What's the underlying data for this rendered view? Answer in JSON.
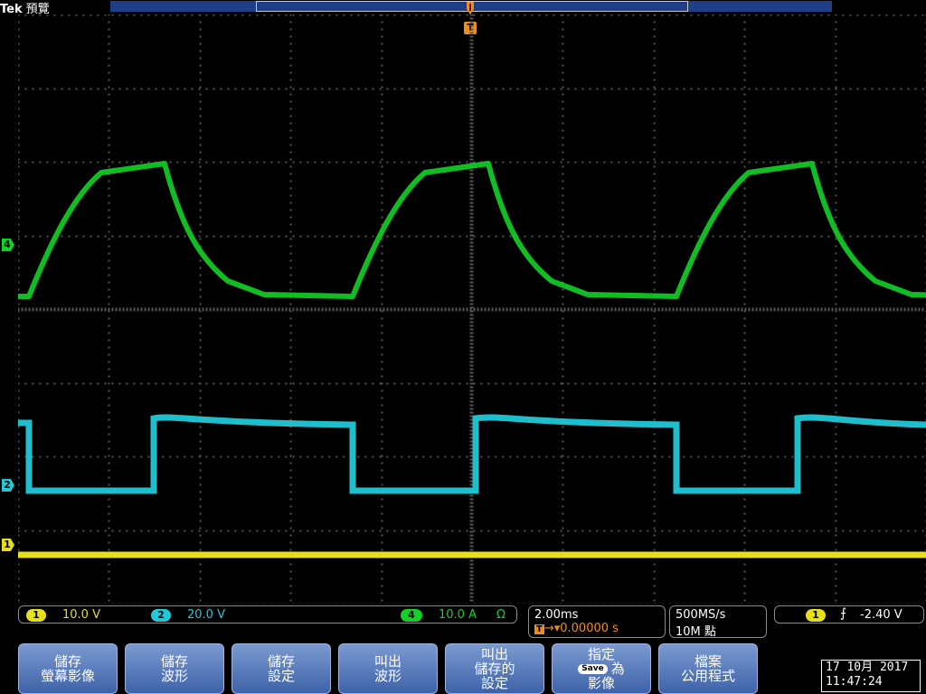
{
  "header": {
    "brand": "Tek",
    "acq_state": "預覽"
  },
  "markers": {
    "ch4": "4",
    "ch2": "2",
    "ch1": "1",
    "trigger": "T"
  },
  "channels": [
    {
      "num": "1",
      "scale": "10.0 V",
      "color": "#e6df1b"
    },
    {
      "num": "2",
      "scale": "20.0 V",
      "color": "#20c8d8"
    },
    {
      "num": "4",
      "scale": "10.0 A",
      "unit": "Ω",
      "color": "#13d227"
    }
  ],
  "timebase": {
    "scale": "2.00ms",
    "delay": "0.00000 s"
  },
  "acquisition": {
    "rate": "500MS/s",
    "record": "10M 點"
  },
  "trigger": {
    "source": "1",
    "slope": "rising",
    "level": "-2.40 V"
  },
  "softkeys": [
    {
      "line1": "儲存",
      "line2": "螢幕影像"
    },
    {
      "line1": "儲存",
      "line2": "波形"
    },
    {
      "line1": "儲存",
      "line2": "設定"
    },
    {
      "line1": "叫出",
      "line2": "波形"
    },
    {
      "line1": "叫出",
      "line2": "儲存的",
      "line3": "設定"
    },
    {
      "line1": "指定",
      "badge": "Save",
      "line2": "為",
      "line3": "影像"
    },
    {
      "line1": "檔案",
      "line2": "公用程式"
    }
  ],
  "datetime": {
    "date": "17 10月 2017",
    "time": "11:47:24"
  },
  "colors": {
    "ch1": "#e6df1b",
    "ch2": "#20c8d8",
    "ch4": "#13d227",
    "trigger": "#f08d1e",
    "softkey": "#4e72b6"
  }
}
